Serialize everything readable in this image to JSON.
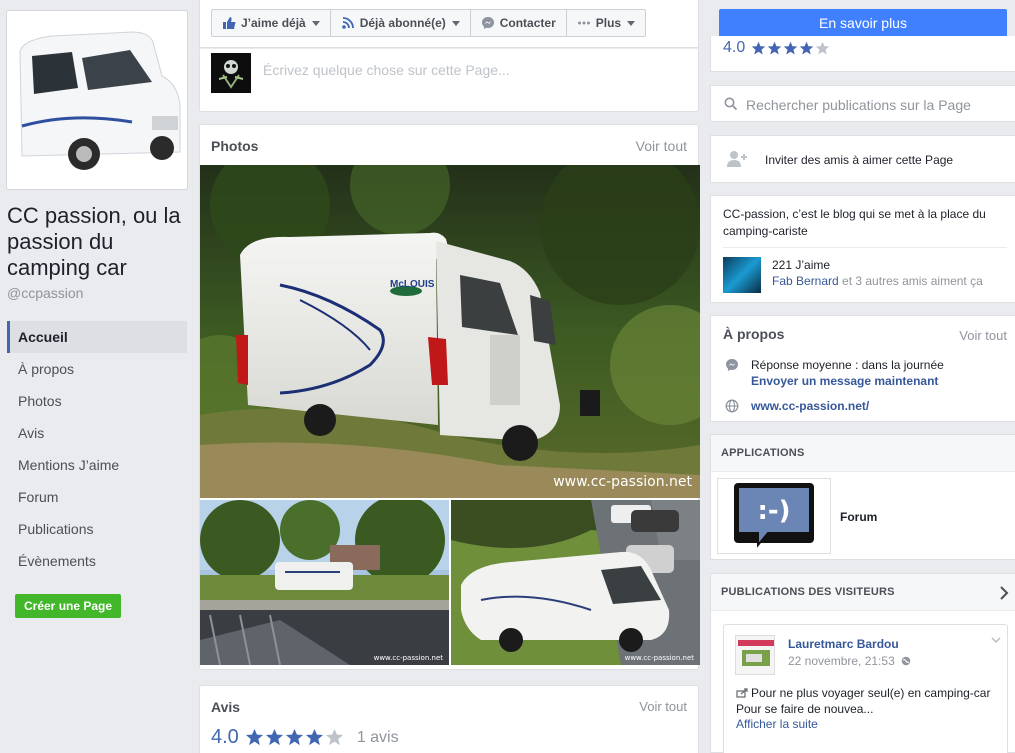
{
  "page": {
    "name": "CC passion, ou la passion du camping car",
    "handle": "@ccpassion"
  },
  "left_nav": {
    "items": [
      {
        "label": "Accueil",
        "active": true
      },
      {
        "label": "À propos"
      },
      {
        "label": "Photos"
      },
      {
        "label": "Avis"
      },
      {
        "label": "Mentions J’aime"
      },
      {
        "label": "Forum"
      },
      {
        "label": "Publications"
      },
      {
        "label": "Évènements"
      }
    ],
    "create_page": "Créer une Page"
  },
  "actions": {
    "like": "J’aime déjà",
    "follow": "Déjà abonné(e)",
    "contact": "Contacter",
    "more": "Plus",
    "learn_more": "En savoir plus"
  },
  "composer": {
    "placeholder": "Écrivez quelque chose sur cette Page..."
  },
  "photos": {
    "title": "Photos",
    "see_all": "Voir tout",
    "watermark": "www.cc-passion.net",
    "watermark_small": "www.cc-passion.net",
    "van_brand": "McLOUIS"
  },
  "reviews": {
    "title": "Avis",
    "see_all": "Voir tout",
    "rating": "4.0",
    "stars_filled": 4,
    "stars_total": 5,
    "count": "1 avis"
  },
  "sidebar": {
    "rating": "4.0",
    "search_placeholder": "Rechercher publications sur la Page",
    "invite": "Inviter des amis à aimer cette Page",
    "description": "CC-passion, c’est le blog qui se met à la place du camping-cariste",
    "likes": "221 J’aime",
    "friend_name": "Fab Bernard",
    "friends_suffix": " et 3 autres amis aiment ça",
    "about": {
      "title": "À propos",
      "see_all": "Voir tout",
      "response": "Réponse moyenne : dans la journée",
      "send_message": "Envoyer un message maintenant",
      "website": "www.cc-passion.net/"
    },
    "apps": {
      "title": "APPLICATIONS",
      "forum_label": "Forum",
      "forum_icon_text": ":-)"
    },
    "visitors": {
      "title": "PUBLICATIONS DES VISITEURS",
      "post": {
        "author": "Lauretmarc Bardou",
        "time": "22 novembre, 21:53",
        "body": "Pour ne plus voyager seul(e) en camping-car Pour se faire de nouvea...",
        "more": "Afficher la suite"
      }
    }
  },
  "colors": {
    "brand_blue": "#4267b2",
    "cta_blue": "#4080ff",
    "green": "#42b72a",
    "link": "#365899",
    "background": "#e9ebee"
  }
}
